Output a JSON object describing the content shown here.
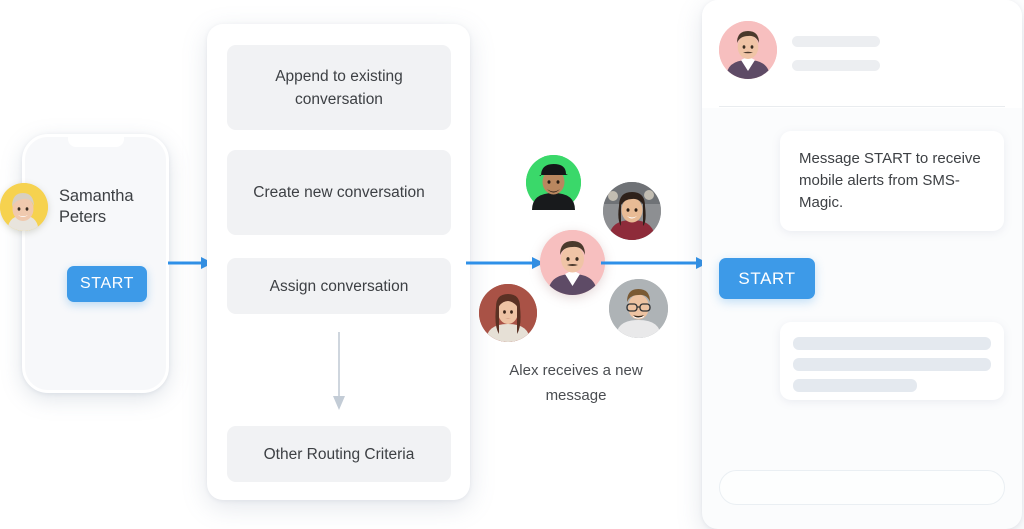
{
  "theme": {
    "accent_blue": "#3d9ae8",
    "panel_bg": "#fbfcfd",
    "chip_bg": "#f1f2f4",
    "text_dark": "#3d4044",
    "skeleton": "#e4e9ef"
  },
  "phone": {
    "contact_name": "Samantha Peters",
    "start_label": "START",
    "avatar": {
      "name": "samantha-avatar",
      "bg": "#f6d24f"
    }
  },
  "routing": {
    "items": [
      {
        "label": "Append to existing conversation"
      },
      {
        "label": "Create new conversation"
      },
      {
        "label": "Assign conversation"
      },
      {
        "label": "Other Routing Criteria"
      }
    ],
    "flow_arrow_icon": "arrow-down-icon"
  },
  "connectors": [
    {
      "name": "arrow-phone-to-routing",
      "icon": "arrow-right-icon"
    },
    {
      "name": "arrow-routing-to-agents",
      "icon": "arrow-right-icon"
    },
    {
      "name": "arrow-agents-to-chat",
      "icon": "arrow-right-icon"
    }
  ],
  "agents": {
    "caption": "Alex receives a new message",
    "avatars": [
      {
        "name": "agent-avatar-green",
        "bg": "#3ad86a"
      },
      {
        "name": "agent-avatar-woman-1",
        "bg": "#9aa0a4"
      },
      {
        "name": "agent-avatar-alex",
        "bg": "#f7bfbf",
        "selected": true
      },
      {
        "name": "agent-avatar-woman-2",
        "bg": "#a95246"
      },
      {
        "name": "agent-avatar-man-2",
        "bg": "#aeb3b6"
      }
    ]
  },
  "chat": {
    "header": {
      "avatar": {
        "name": "chat-header-avatar",
        "bg": "#f7bfbf"
      },
      "skeleton_lines": 2
    },
    "incoming_message": "Message START to receive mobile alerts from SMS-Magic.",
    "start_label": "START",
    "reply_skeleton_lines": 3,
    "input_placeholder": ""
  }
}
